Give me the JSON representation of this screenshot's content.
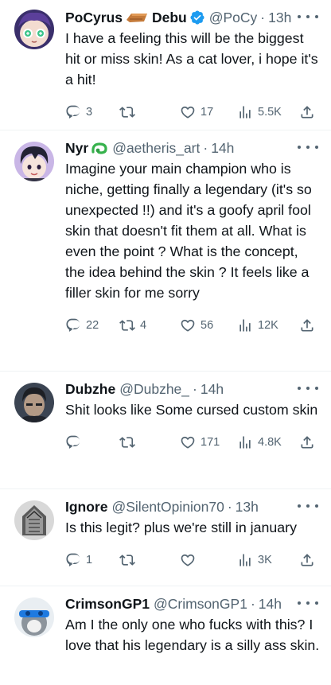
{
  "tweets": [
    {
      "name": "PoCyrus",
      "name2": "Debu",
      "handle": "@PoCy",
      "time": "13h",
      "text": "I have a feeling this will be the biggest hit or miss skin! As a cat lover, i hope it's a hit!",
      "replies": "3",
      "retweets": "",
      "likes": "17",
      "views": "5.5K"
    },
    {
      "name": "Nyr",
      "handle": "@aetheris_art",
      "time": "14h",
      "text": "Imagine your main champion who is niche, getting finally a legendary (it's so unexpected !!) and it's a goofy april fool skin that doesn't fit them at all. What is even the point ? What is the concept, the idea behind the skin ? It feels like a filler skin for me sorry",
      "replies": "22",
      "retweets": "4",
      "likes": "56",
      "views": "12K"
    },
    {
      "name": "Dubzhe",
      "handle": "@Dubzhe_",
      "time": "14h",
      "text": "Shit looks like Some cursed custom skin",
      "replies": "",
      "retweets": "",
      "likes": "171",
      "views": "4.8K"
    },
    {
      "name": "Ignore",
      "handle": "@SilentOpinion70",
      "time": "13h",
      "text": "Is this legit? plus we're still in january",
      "replies": "1",
      "retweets": "",
      "likes": "",
      "views": "3K"
    },
    {
      "name": "CrimsonGP1",
      "handle": "@CrimsonGP1",
      "time": "14h",
      "text": "Am I the only one who fucks with this? I love that his legendary is a silly ass skin."
    }
  ],
  "colors": {
    "text": "#0f1419",
    "secondary": "#536471",
    "verified": "#1d9bf0",
    "divider": "#eff3f4"
  },
  "icons": [
    "reply-icon",
    "retweet-icon",
    "like-icon",
    "views-icon",
    "share-icon",
    "more-icon",
    "verified-badge-icon",
    "coffin-emoji-icon",
    "snake-emoji-icon"
  ]
}
